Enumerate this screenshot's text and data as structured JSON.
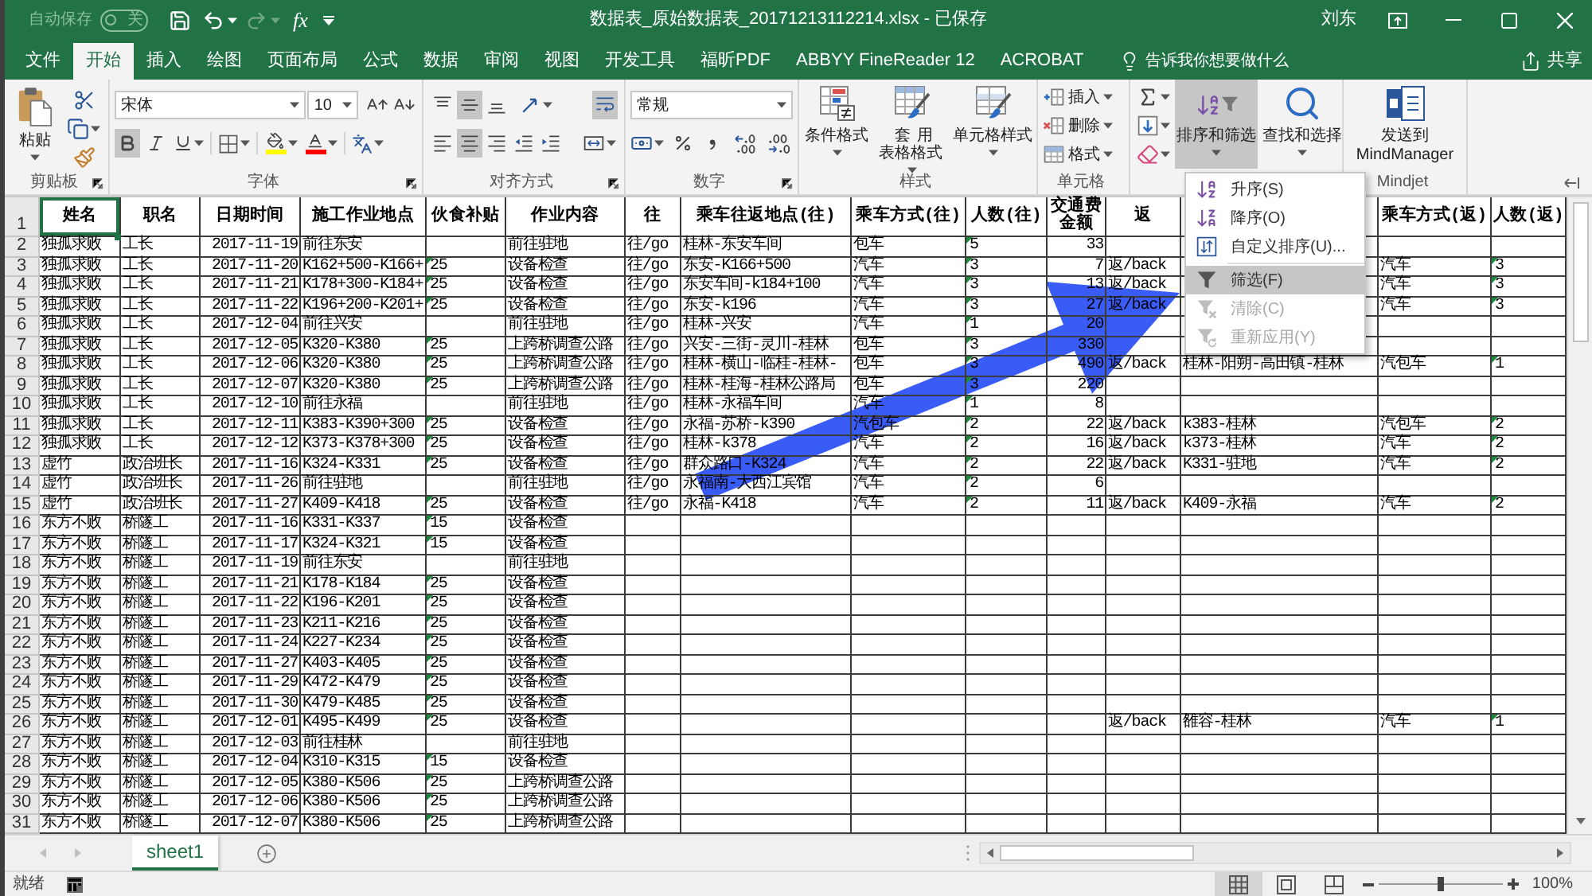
{
  "title_bar": {
    "autosave": {
      "label": "自动保存",
      "on": false,
      "state_text": "关"
    },
    "redo": {
      "disabled": true
    },
    "function_button": "fx",
    "title": "数据表_原始数据表_20171213112214.xlsx - 已保存",
    "user": "刘东"
  },
  "ribbon_tabs": [
    {
      "label": "文件",
      "selected": false
    },
    {
      "label": "开始",
      "selected": true
    },
    {
      "label": "插入",
      "selected": false
    },
    {
      "label": "绘图",
      "selected": false
    },
    {
      "label": "页面布局",
      "selected": false
    },
    {
      "label": "公式",
      "selected": false
    },
    {
      "label": "数据",
      "selected": false
    },
    {
      "label": "审阅",
      "selected": false
    },
    {
      "label": "视图",
      "selected": false
    },
    {
      "label": "开发工具",
      "selected": false
    },
    {
      "label": "福昕PDF",
      "selected": false
    },
    {
      "label": "ABBYY FineReader 12",
      "selected": false
    },
    {
      "label": "ACROBAT",
      "selected": false
    }
  ],
  "tell_me": "告诉我你想要做什么",
  "share": "共享",
  "ribbon": {
    "clipboard": {
      "paste": "粘贴",
      "label": "剪贴板"
    },
    "font": {
      "name": "宋体",
      "size": "10",
      "bold": true,
      "italic": false,
      "underline": false,
      "label": "字体"
    },
    "alignment": {
      "top": false,
      "middle": true,
      "bottom": false,
      "left": false,
      "center": true,
      "right": false,
      "wrap_text": true,
      "label": "对齐方式"
    },
    "number": {
      "format": "常规",
      "label": "数字"
    },
    "styles": {
      "buttons": [
        {
          "kind": "conditional",
          "label": "条件格式"
        },
        {
          "kind": "table",
          "label": "套用表格格式"
        },
        {
          "kind": "cell",
          "label": "单元格样式"
        }
      ],
      "label": "样式"
    },
    "cells": {
      "buttons": [
        {
          "kind": "insert",
          "label": "插入"
        },
        {
          "kind": "delete",
          "label": "删除"
        },
        {
          "kind": "format",
          "label": "格式"
        }
      ],
      "label": "单元格"
    },
    "editing": {
      "sort_filter": {
        "label": "排序和筛选",
        "pressed": true
      },
      "find_select": {
        "label": "查找和选择",
        "pressed": false
      }
    },
    "mindjet": {
      "button": "发送到 MindManager",
      "label": "Mindjet"
    }
  },
  "sort_menu": {
    "items": [
      {
        "kind": "sort_ascending",
        "label": "升序(S)",
        "highlighted": false,
        "disabled": false
      },
      {
        "kind": "sort_descending",
        "label": "降序(O)",
        "highlighted": false,
        "disabled": false
      },
      {
        "kind": "custom_sort",
        "label": "自定义排序(U)...",
        "highlighted": false,
        "disabled": false
      },
      {
        "kind": "separator"
      },
      {
        "kind": "filter",
        "label": "筛选(F)",
        "highlighted": true,
        "disabled": false
      },
      {
        "kind": "clear",
        "label": "清除(C)",
        "highlighted": false,
        "disabled": true
      },
      {
        "kind": "reapply",
        "label": "重新应用(Y)",
        "highlighted": false,
        "disabled": true
      }
    ]
  },
  "sheet": {
    "header_row": {
      "number": "1",
      "cells": [
        {
          "label": "姓名",
          "selected": true
        },
        {
          "label": "职名",
          "selected": false
        },
        {
          "label": "日期时间",
          "selected": false
        },
        {
          "label": "施工作业地点",
          "selected": false
        },
        {
          "label": "伙食补贴",
          "selected": false
        },
        {
          "label": "作业内容",
          "selected": false
        },
        {
          "label": "往",
          "selected": false
        },
        {
          "label": "乘车往返地点(往)",
          "selected": false
        },
        {
          "label": "乘车方式(往)",
          "selected": false
        },
        {
          "label": "人数(往)",
          "selected": false
        },
        {
          "label": "交通费金额",
          "selected": false
        },
        {
          "label": "返",
          "selected": false
        },
        {
          "selected": false
        },
        {
          "label": "乘车方式(返)",
          "selected": false
        },
        {
          "label": "人数(返)",
          "selected": false
        }
      ]
    },
    "rows": [
      {
        "number": "2",
        "cells": [
          "独孤求败",
          "工长",
          "2017-11-19",
          "前往东安",
          null,
          "前往驻地",
          "往/go",
          "桂林-东安车间",
          "包车",
          {
            "text": "5",
            "flag": true
          },
          "33"
        ]
      },
      {
        "number": "3",
        "cells": [
          "独孤求败",
          "工长",
          "2017-11-20",
          "K162+500-K166+",
          {
            "text": "25",
            "flag": true
          },
          "设备检查",
          "往/go",
          "东安-K166+500",
          "汽车",
          {
            "text": "3",
            "flag": true
          },
          "7",
          "返/back",
          null,
          "汽车",
          {
            "text": "3",
            "flag": true
          }
        ]
      },
      {
        "number": "4",
        "cells": [
          "独孤求败",
          "工长",
          "2017-11-21",
          "K178+300-K184+",
          {
            "text": "25",
            "flag": true
          },
          "设备检查",
          "往/go",
          "东安车间-k184+100",
          "汽车",
          {
            "text": "3",
            "flag": true
          },
          "13",
          "返/back",
          null,
          "汽车",
          {
            "text": "3",
            "flag": true
          }
        ]
      },
      {
        "number": "5",
        "cells": [
          "独孤求败",
          "工长",
          "2017-11-22",
          "K196+200-K201+",
          {
            "text": "25",
            "flag": true
          },
          "设备检查",
          "往/go",
          "东安-k196",
          "汽车",
          {
            "text": "3",
            "flag": true
          },
          "27",
          "返/back",
          null,
          "汽车",
          {
            "text": "3",
            "flag": true
          }
        ]
      },
      {
        "number": "6",
        "cells": [
          "独孤求败",
          "工长",
          "2017-12-04",
          "前往兴安",
          null,
          "前往驻地",
          "往/go",
          "桂林-兴安",
          "汽车",
          {
            "text": "1",
            "flag": true
          },
          "20"
        ]
      },
      {
        "number": "7",
        "cells": [
          "独孤求败",
          "工长",
          "2017-12-05",
          "K320-K380",
          {
            "text": "25",
            "flag": true
          },
          "上跨桥调查公路",
          "往/go",
          "兴安-三街-灵川-桂林",
          "包车",
          {
            "text": "3",
            "flag": true
          },
          "330"
        ]
      },
      {
        "number": "8",
        "cells": [
          "独孤求败",
          "工长",
          "2017-12-06",
          "K320-K380",
          {
            "text": "25",
            "flag": true
          },
          "上跨桥调查公路",
          "往/go",
          "桂林-横山-临桂-桂林-",
          "包车",
          {
            "text": "3",
            "flag": true
          },
          "490",
          "返/back",
          "桂林-阳朔-高田镇-桂林",
          "汽包车",
          {
            "text": "1",
            "flag": true
          }
        ]
      },
      {
        "number": "9",
        "cells": [
          "独孤求败",
          "工长",
          "2017-12-07",
          "K320-K380",
          {
            "text": "25",
            "flag": true
          },
          "上跨桥调查公路",
          "往/go",
          "桂林-桂海-桂林公路局",
          "包车",
          {
            "text": "3",
            "flag": true
          },
          "220"
        ]
      },
      {
        "number": "10",
        "cells": [
          "独孤求败",
          "工长",
          "2017-12-10",
          "前往永福",
          null,
          "前往驻地",
          "往/go",
          "桂林-永福车间",
          "汽车",
          {
            "text": "1",
            "flag": true
          },
          "8"
        ]
      },
      {
        "number": "11",
        "cells": [
          "独孤求败",
          "工长",
          "2017-12-11",
          "K383-K390+300",
          {
            "text": "25",
            "flag": true
          },
          "设备检查",
          "往/go",
          "永福-苏桥-k390",
          "汽包车",
          {
            "text": "2",
            "flag": true
          },
          "22",
          "返/back",
          "k383-桂林",
          "汽包车",
          {
            "text": "2",
            "flag": true
          }
        ]
      },
      {
        "number": "12",
        "cells": [
          "独孤求败",
          "工长",
          "2017-12-12",
          "K373-K378+300",
          {
            "text": "25",
            "flag": true
          },
          "设备检查",
          "往/go",
          "桂林-k378",
          "汽车",
          {
            "text": "2",
            "flag": true
          },
          "16",
          "返/back",
          "k373-桂林",
          "汽车",
          {
            "text": "2",
            "flag": true
          }
        ]
      },
      {
        "number": "13",
        "cells": [
          "虚竹",
          "政治班长",
          "2017-11-16",
          "K324-K331",
          {
            "text": "25",
            "flag": true
          },
          "设备检查",
          "往/go",
          "群众路口-K324",
          "汽车",
          {
            "text": "2",
            "flag": true
          },
          "22",
          "返/back",
          "K331-驻地",
          "汽车",
          {
            "text": "2",
            "flag": true
          }
        ]
      },
      {
        "number": "14",
        "cells": [
          "虚竹",
          "政治班长",
          "2017-11-26",
          "前往驻地",
          null,
          "前往驻地",
          "往/go",
          "永福南-大西江宾馆",
          "汽车",
          {
            "text": "2",
            "flag": true
          },
          "6"
        ]
      },
      {
        "number": "15",
        "cells": [
          "虚竹",
          "政治班长",
          "2017-11-27",
          "K409-K418",
          {
            "text": "25",
            "flag": true
          },
          "设备检查",
          "往/go",
          "永福-K418",
          "汽车",
          {
            "text": "2",
            "flag": true
          },
          "11",
          "返/back",
          "K409-永福",
          "汽车",
          {
            "text": "2",
            "flag": true
          }
        ]
      },
      {
        "number": "16",
        "cells": [
          "东方不败",
          "桥隧工",
          "2017-11-16",
          "K331-K337",
          {
            "text": "15",
            "flag": true
          },
          "设备检查"
        ]
      },
      {
        "number": "17",
        "cells": [
          "东方不败",
          "桥隧工",
          "2017-11-17",
          "K324-K321",
          {
            "text": "15",
            "flag": true
          },
          "设备检查"
        ]
      },
      {
        "number": "18",
        "cells": [
          "东方不败",
          "桥隧工",
          "2017-11-19",
          "前往东安",
          null,
          "前往驻地"
        ]
      },
      {
        "number": "19",
        "cells": [
          "东方不败",
          "桥隧工",
          "2017-11-21",
          "K178-K184",
          {
            "text": "25",
            "flag": true
          },
          "设备检查"
        ]
      },
      {
        "number": "20",
        "cells": [
          "东方不败",
          "桥隧工",
          "2017-11-22",
          "K196-K201",
          {
            "text": "25",
            "flag": true
          },
          "设备检查"
        ]
      },
      {
        "number": "21",
        "cells": [
          "东方不败",
          "桥隧工",
          "2017-11-23",
          "K211-K216",
          {
            "text": "25",
            "flag": true
          },
          "设备检查"
        ]
      },
      {
        "number": "22",
        "cells": [
          "东方不败",
          "桥隧工",
          "2017-11-24",
          "K227-K234",
          {
            "text": "25",
            "flag": true
          },
          "设备检查"
        ]
      },
      {
        "number": "23",
        "cells": [
          "东方不败",
          "桥隧工",
          "2017-11-27",
          "K403-K405",
          {
            "text": "25",
            "flag": true
          },
          "设备检查"
        ]
      },
      {
        "number": "24",
        "cells": [
          "东方不败",
          "桥隧工",
          "2017-11-29",
          "K472-K479",
          {
            "text": "25",
            "flag": true
          },
          "设备检查"
        ]
      },
      {
        "number": "25",
        "cells": [
          "东方不败",
          "桥隧工",
          "2017-11-30",
          "K479-K485",
          {
            "text": "25",
            "flag": true
          },
          "设备检查"
        ]
      },
      {
        "number": "26",
        "cells": [
          "东方不败",
          "桥隧工",
          "2017-12-01",
          "K495-K499",
          {
            "text": "25",
            "flag": true
          },
          "设备检查",
          null,
          null,
          null,
          null,
          null,
          "返/back",
          "雒容-桂林",
          "汽车",
          {
            "text": "1",
            "flag": true
          }
        ]
      },
      {
        "number": "27",
        "cells": [
          "东方不败",
          "桥隧工",
          "2017-12-03",
          "前往桂林",
          null,
          "前往驻地"
        ]
      },
      {
        "number": "28",
        "cells": [
          "东方不败",
          "桥隧工",
          "2017-12-04",
          "K310-K315",
          {
            "text": "15",
            "flag": true
          },
          "设备检查"
        ]
      },
      {
        "number": "29",
        "cells": [
          "东方不败",
          "桥隧工",
          "2017-12-05",
          "K380-K506",
          {
            "text": "25",
            "flag": true
          },
          "上跨桥调查公路"
        ]
      },
      {
        "number": "30",
        "cells": [
          "东方不败",
          "桥隧工",
          "2017-12-06",
          "K380-K506",
          {
            "text": "25",
            "flag": true
          },
          "上跨桥调查公路"
        ]
      },
      {
        "number": "31",
        "cells": [
          "东方不败",
          "桥隧工",
          "2017-12-07",
          "K380-K506",
          {
            "text": "25",
            "flag": true
          },
          "上跨桥调查公路"
        ]
      }
    ]
  },
  "sheet_tabs": [
    {
      "label": "sheet1",
      "selected": true
    }
  ],
  "status_bar": {
    "status": "就绪",
    "views": [
      {
        "kind": "normal",
        "selected": true
      },
      {
        "kind": "page_layout",
        "selected": false
      },
      {
        "kind": "page_break",
        "selected": false
      }
    ],
    "zoom": {
      "level": 0.5,
      "label": "100%"
    }
  }
}
